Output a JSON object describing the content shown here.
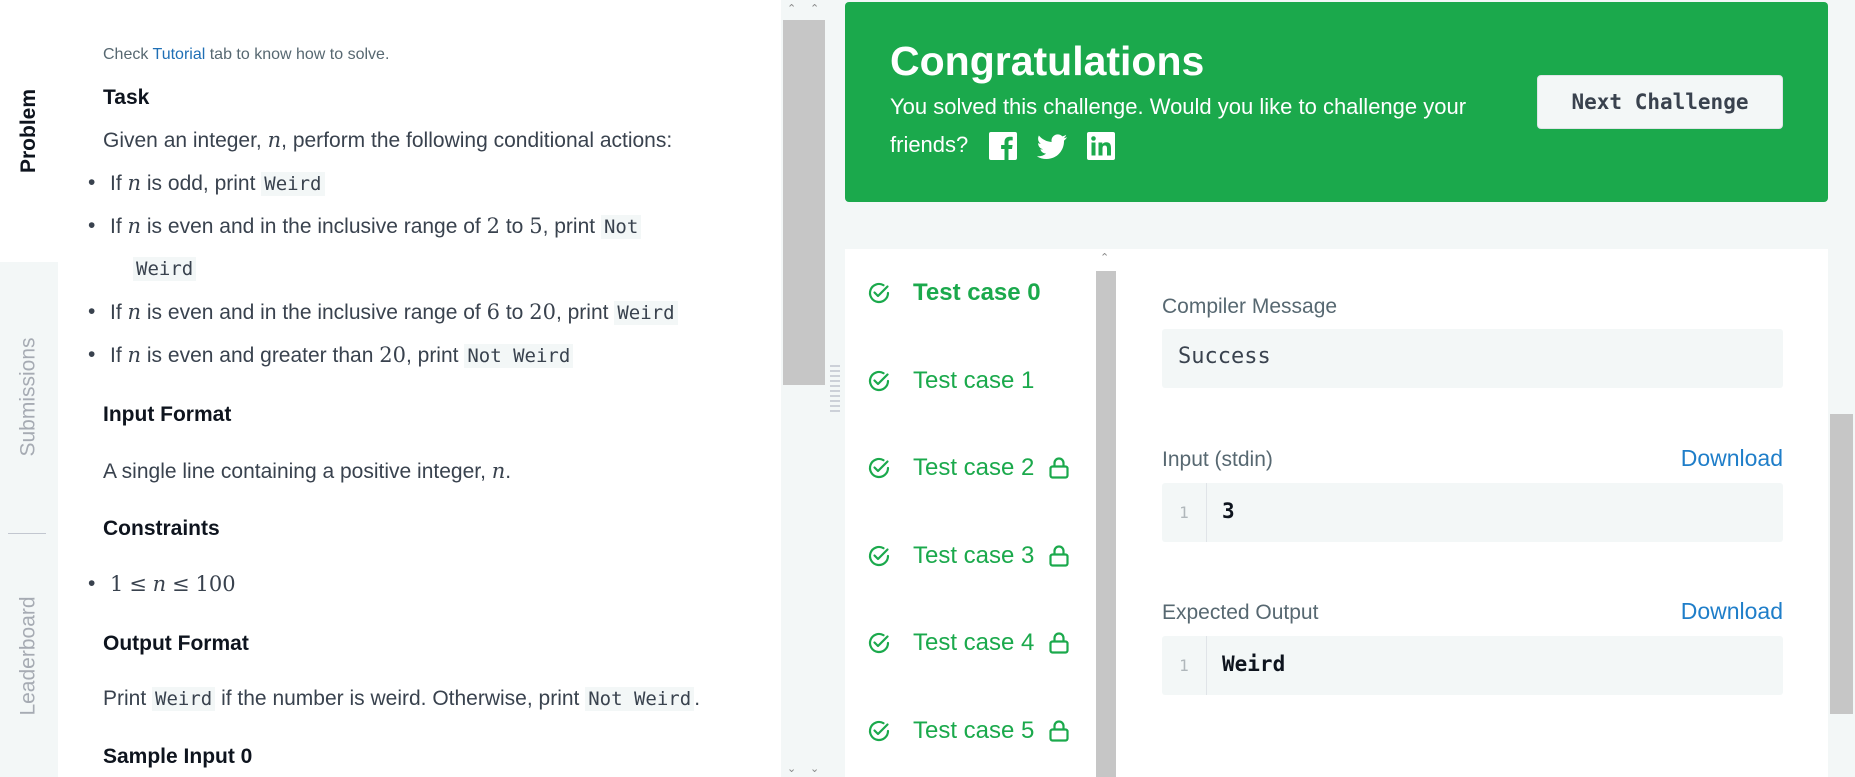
{
  "tabs": [
    {
      "label": "Problem",
      "active": true
    },
    {
      "label": "Submissions",
      "active": false
    },
    {
      "label": "Leaderboard",
      "active": false
    }
  ],
  "problem": {
    "hint_prefix": "Check",
    "hint_link": "Tutorial",
    "hint_suffix": "tab to know how to solve.",
    "task_heading": "Task",
    "task_intro_a": "Given an integer,",
    "task_intro_var": "n",
    "task_intro_b": ", perform the following conditional actions:",
    "bullets": [
      {
        "a": "If",
        "var": "n",
        "b": "is odd, print",
        "code": "Weird"
      },
      {
        "a": "If",
        "var": "n",
        "b": "is even and in the inclusive range of",
        "n1": "2",
        "mid": "to",
        "n2": "5",
        "c": ", print",
        "code": "Not",
        "code2": "Weird"
      },
      {
        "a": "If",
        "var": "n",
        "b": "is even and in the inclusive range of",
        "n1": "6",
        "mid": "to",
        "n2": "20",
        "c": ", print",
        "code": "Weird"
      },
      {
        "a": "If",
        "var": "n",
        "b": "is even and greater than",
        "n1": "20",
        "c": ", print",
        "code": "Not Weird"
      }
    ],
    "input_heading": "Input Format",
    "input_text": "A single line containing a positive integer,",
    "input_var": "n",
    "constraints_heading": "Constraints",
    "constraint_lo": "1",
    "constraint_le": "≤",
    "constraint_var": "n",
    "constraint_hi": "100",
    "output_heading": "Output Format",
    "output_a": "Print",
    "output_code1": "Weird",
    "output_b": "if the number is weird. Otherwise, print",
    "output_code2": "Not Weird",
    "sample_heading": "Sample Input 0"
  },
  "banner": {
    "title": "Congratulations",
    "text": "You solved this challenge. Would you like to challenge your friends?",
    "share_icons": [
      "facebook-icon",
      "twitter-icon",
      "linkedin-icon"
    ],
    "next_label": "Next Challenge",
    "color": "#1ba94c"
  },
  "test_cases": [
    {
      "label": "Test case 0",
      "locked": false,
      "active": true
    },
    {
      "label": "Test case 1",
      "locked": false,
      "active": false
    },
    {
      "label": "Test case 2",
      "locked": true,
      "active": false
    },
    {
      "label": "Test case 3",
      "locked": true,
      "active": false
    },
    {
      "label": "Test case 4",
      "locked": true,
      "active": false
    },
    {
      "label": "Test case 5",
      "locked": true,
      "active": false
    }
  ],
  "details": {
    "compiler_label": "Compiler Message",
    "compiler_value": "Success",
    "input_label": "Input (stdin)",
    "input_download": "Download",
    "input_line_no": "1",
    "input_value": "3",
    "expected_label": "Expected Output",
    "expected_download": "Download",
    "expected_line_no": "1",
    "expected_value": "Weird"
  },
  "colors": {
    "success": "#1ba94c",
    "link": "#1f7ec9"
  }
}
